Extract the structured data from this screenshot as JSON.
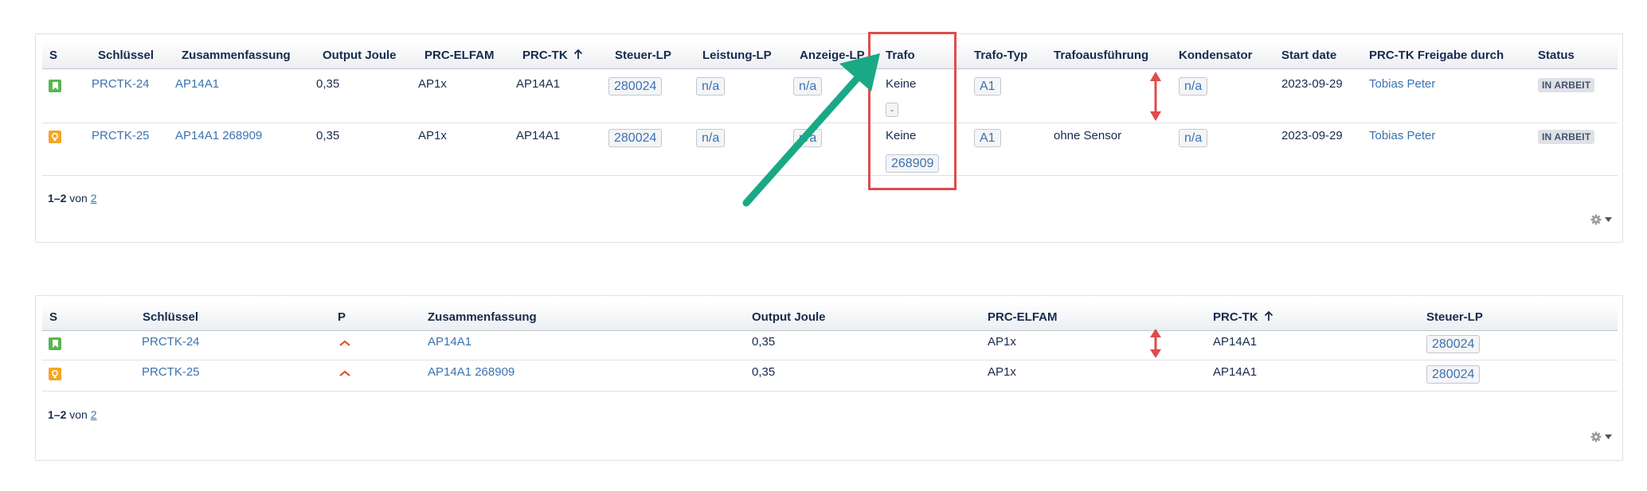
{
  "table1": {
    "headers": [
      "S",
      "Schlüssel",
      "Zusammenfassung",
      "Output Joule",
      "PRC-ELFAM",
      "PRC-TK",
      "Steuer-LP",
      "Leistung-LP",
      "Anzeige-LP",
      "Trafo",
      "Trafo-Typ",
      "Trafoausführung",
      "Kondensator",
      "Start date",
      "PRC-TK Freigabe durch",
      "Status"
    ],
    "rows": [
      {
        "type_icon": "story-icon",
        "key": "PRCTK-24",
        "summary": "AP14A1",
        "output_joule": "0,35",
        "elfam": "AP1x",
        "prctk": "AP14A1",
        "steuer_lp": "280024",
        "leistung_lp": "n/a",
        "anzeige_lp": "n/a",
        "trafo": "Keine",
        "trafo_lozenge": "-",
        "trafo_typ": "A1",
        "trafoausfuehrung": "",
        "kondensator": "n/a",
        "start_date": "2023-09-29",
        "freigabe": "Tobias Peter",
        "status": "IN ARBEIT"
      },
      {
        "type_icon": "idea-icon",
        "key": "PRCTK-25",
        "summary": "AP14A1 268909",
        "output_joule": "0,35",
        "elfam": "AP1x",
        "prctk": "AP14A1",
        "steuer_lp": "280024",
        "leistung_lp": "n/a",
        "anzeige_lp": "n/a",
        "trafo": "Keine",
        "trafo_lozenge": "268909",
        "trafo_typ": "A1",
        "trafoausfuehrung": "ohne Sensor",
        "kondensator": "n/a",
        "start_date": "2023-09-29",
        "freigabe": "Tobias Peter",
        "status": "IN ARBEIT"
      }
    ],
    "pager": {
      "range": "1–2",
      "of": "von",
      "total": "2"
    }
  },
  "table2": {
    "headers": [
      "S",
      "Schlüssel",
      "P",
      "Zusammenfassung",
      "Output Joule",
      "PRC-ELFAM",
      "PRC-TK",
      "Steuer-LP"
    ],
    "rows": [
      {
        "type_icon": "story-icon",
        "key": "PRCTK-24",
        "priority": "major-priority-icon",
        "summary": "AP14A1",
        "output_joule": "0,35",
        "elfam": "AP1x",
        "prctk": "AP14A1",
        "steuer_lp": "280024"
      },
      {
        "type_icon": "idea-icon",
        "key": "PRCTK-25",
        "priority": "major-priority-icon",
        "summary": "AP14A1 268909",
        "output_joule": "0,35",
        "elfam": "AP1x",
        "prctk": "AP14A1",
        "steuer_lp": "280024"
      }
    ],
    "pager": {
      "range": "1–2",
      "of": "von",
      "total": "2"
    }
  },
  "colors": {
    "highlight_box": "#e04b4b",
    "arrow_green": "#1aa985",
    "arrow_red": "#e04b4b",
    "link": "#3b73af",
    "story": "#5ab552",
    "idea": "#f5a623"
  }
}
